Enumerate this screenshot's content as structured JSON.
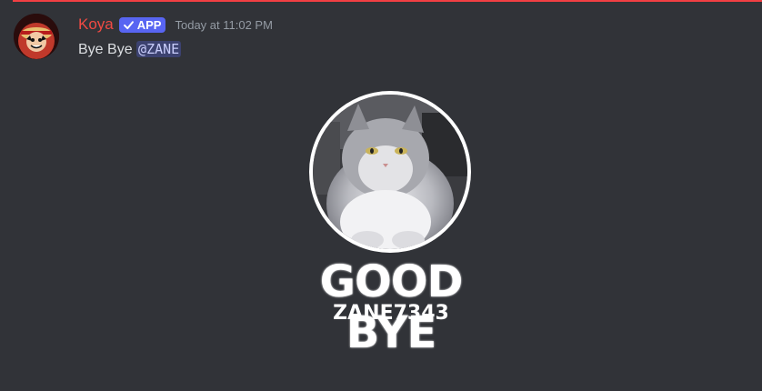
{
  "message": {
    "author": "Koya",
    "badge": {
      "label": "APP",
      "icon": "check-icon"
    },
    "timestamp": "Today at 11:02 PM",
    "text": "Bye Bye",
    "mention": "@ZANE"
  },
  "embed_image": {
    "title": "GOOD BYE",
    "username": "ZANE7343",
    "photo_subject": "cat-photo"
  },
  "colors": {
    "background": "#313338",
    "author": "#f04a43",
    "badge": "#5865f2",
    "mention_bg": "#3c4270",
    "mention_text": "#c9cdfb",
    "separator": "#f23f43"
  }
}
